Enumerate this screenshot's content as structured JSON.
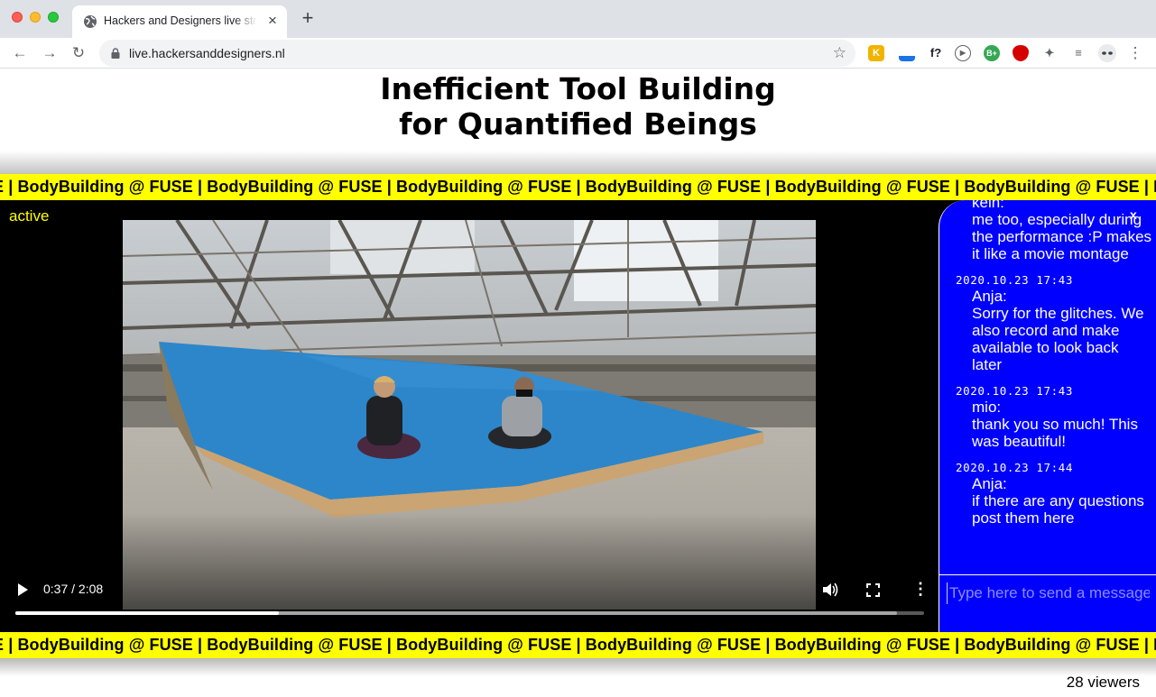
{
  "browser": {
    "tab_title": "Hackers and Designers live stream",
    "url": "live.hackersanddesigners.nl",
    "tab_close": "×",
    "new_tab": "+",
    "nav": {
      "back": "←",
      "forward": "→",
      "reload": "↻"
    },
    "extensions": [
      {
        "name": "k-extension-icon",
        "label": "K",
        "color": "#f0b400"
      },
      {
        "name": "pen-extension-icon",
        "label": "",
        "color": "#1a73e8"
      },
      {
        "name": "fontface-extension-icon",
        "label": "f?",
        "color": "#202124"
      },
      {
        "name": "play-extension-icon",
        "label": "▶",
        "color": "#5f6368"
      },
      {
        "name": "bplus-extension-icon",
        "label": "B+",
        "color": "#34a853"
      },
      {
        "name": "shield-extension-icon",
        "label": "",
        "color": "#d50000"
      },
      {
        "name": "puzzle-extension-icon",
        "label": "",
        "color": "#5f6368"
      },
      {
        "name": "media-queue-icon",
        "label": "",
        "color": "#5f6368"
      }
    ]
  },
  "page": {
    "title_line1": "Inefficient Tool Building",
    "title_line2": "for Quantified Beings",
    "marquee_text": "E | BodyBuilding @ FUSE | BodyBuilding @ FUSE | BodyBuilding @ FUSE | BodyBuilding @ FUSE | BodyBuilding @ FUSE | BodyBuilding @ FUSE | B",
    "status_label": "active",
    "viewers": "28 viewers",
    "colors": {
      "marquee": "#ffff00",
      "chat_bg": "#0000ff",
      "stage_bg": "#000000",
      "status": "#ffff00"
    }
  },
  "video": {
    "time_display": "0:37 / 2:08",
    "progress": 0.29,
    "buffered": 0.97
  },
  "chat": {
    "close_label": "x",
    "placeholder": "Type here to send a message",
    "messages": [
      {
        "timestamp": "",
        "user": "kein:",
        "text": "me too, especially during the performance :P makes it like a movie montage"
      },
      {
        "timestamp": "2020.10.23 17:43",
        "user": "Anja:",
        "text": "Sorry for the glitches. We also record and make available to look back later"
      },
      {
        "timestamp": "2020.10.23 17:43",
        "user": "mio:",
        "text": "thank you so much! This was beautiful!"
      },
      {
        "timestamp": "2020.10.23 17:44",
        "user": "Anja:",
        "text": "if there are any questions post them here"
      }
    ]
  }
}
